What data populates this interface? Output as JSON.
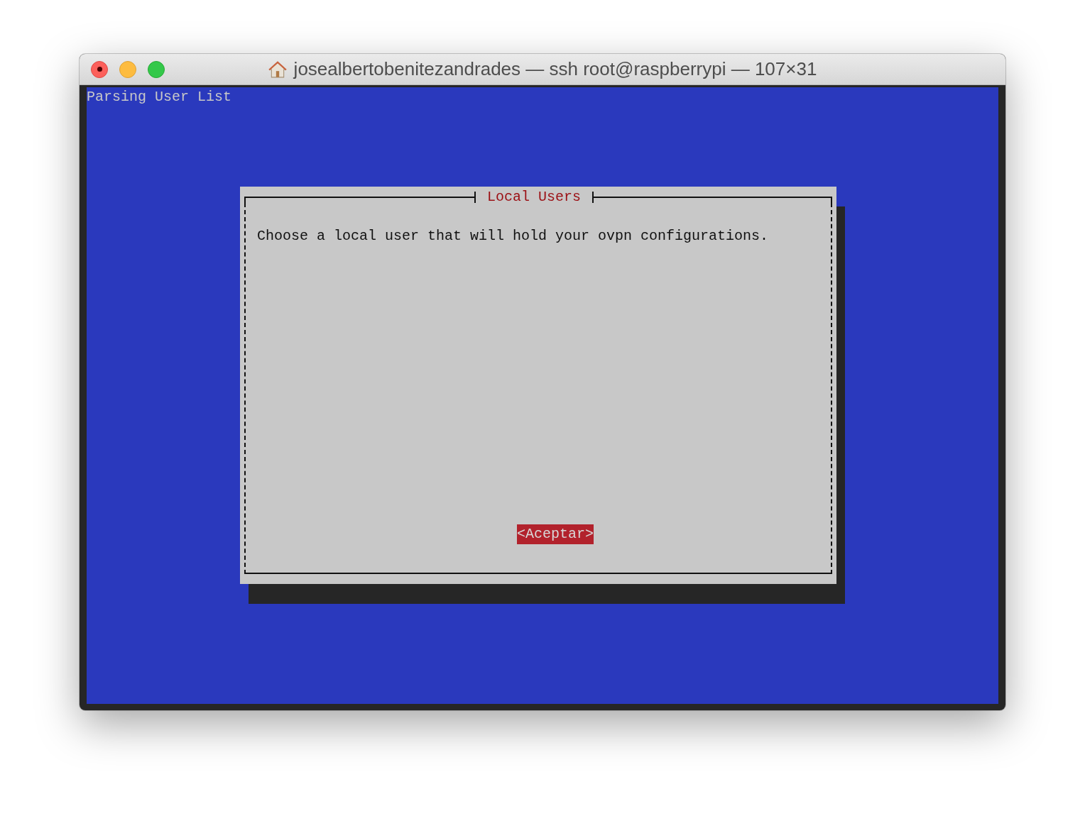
{
  "window": {
    "title": "josealbertobenitezandrades — ssh root@raspberrypi — 107×31"
  },
  "terminal": {
    "status_line": "Parsing User List"
  },
  "dialog": {
    "title": "Local Users",
    "message": "Choose a local user that will hold your ovpn configurations.",
    "buttons": [
      {
        "label": "<Aceptar>",
        "selected": true
      }
    ]
  }
}
